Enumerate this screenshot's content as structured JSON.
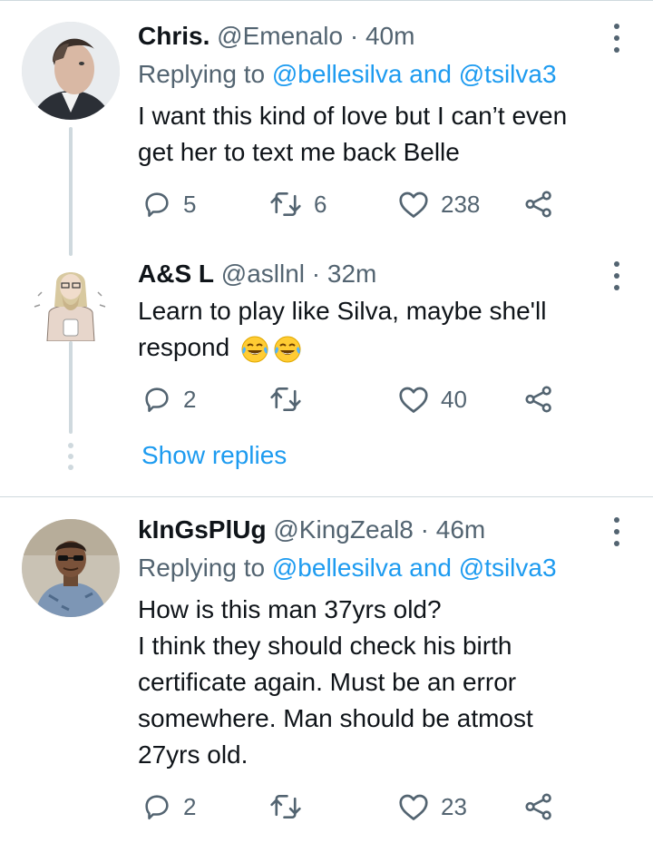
{
  "colors": {
    "accent": "#1d9bf0",
    "muted": "#536471",
    "text": "#0f1419",
    "line": "#cfd9de"
  },
  "tweets": [
    {
      "name": "Chris.",
      "handle": "@Emenalo",
      "sep": "·",
      "time": "40m",
      "replying_prefix": "Replying to",
      "replying_mentions": "@bellesilva and @tsilva3",
      "lines": [
        "I want this kind of love but I can’t even",
        "get her to text me back Belle"
      ],
      "reply_count": "5",
      "retweet_count": "6",
      "like_count": "238",
      "icons": {
        "reply": "reply-icon",
        "retweet": "retweet-icon",
        "like": "heart-icon",
        "share": "share-icon",
        "more": "more-icon"
      }
    },
    {
      "name": "A&S L",
      "handle": "@asllnl",
      "sep": "·",
      "time": "32m",
      "lines": [
        "Learn to play like Silva, maybe she'll",
        "respond"
      ],
      "emoji": [
        "tears-of-joy-emoji",
        "tears-of-joy-emoji"
      ],
      "reply_count": "2",
      "retweet_count": "",
      "like_count": "40",
      "show_replies": "Show replies"
    },
    {
      "name": "kInGsPlUg",
      "handle": "@KingZeal8",
      "sep": "·",
      "time": "46m",
      "replying_prefix": "Replying to",
      "replying_mentions": "@bellesilva and @tsilva3",
      "lines": [
        "How is this man 37yrs old?",
        "I think they should check his birth",
        "certificate again. Must be an error",
        "somewhere. Man should be atmost",
        "27yrs old."
      ],
      "reply_count": "2",
      "retweet_count": "",
      "like_count": "23"
    }
  ]
}
